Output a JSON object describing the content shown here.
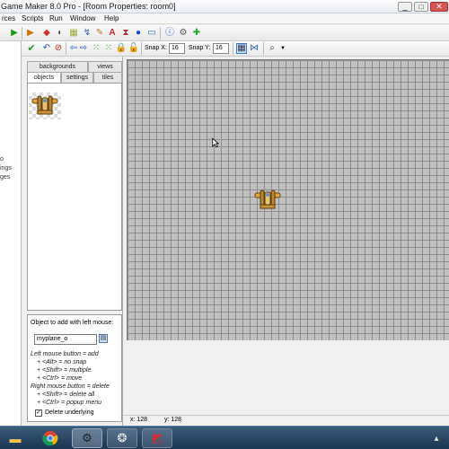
{
  "title": "Game Maker 8.0 Pro - [Room Properties: room0]",
  "menu": {
    "items": [
      "rces",
      "Scripts",
      "Run",
      "Window",
      "Help"
    ]
  },
  "left_strip": {
    "labels": [
      "o",
      "ings",
      "ges"
    ]
  },
  "toolbar2": {
    "snap_x_label": "Snap X:",
    "snap_x_value": "16",
    "snap_y_label": "Snap Y:",
    "snap_y_value": "16"
  },
  "tabs": {
    "backgrounds": "backgrounds",
    "views": "views",
    "objects": "objects",
    "settings": "settings",
    "tiles": "tiles"
  },
  "object_panel": {
    "heading": "Object to add with left mouse:",
    "selected_object": "myplane_o",
    "help_lines": [
      "Left mouse button = add",
      "+ <Alt> = no snap",
      "+ <Shift> = multiple",
      "+ <Ctrl> = move",
      "Right mouse button = delete",
      "+ <Shift> = delete all",
      "+ <Ctrl> = popup menu"
    ],
    "delete_underlying_label": "Delete underlying",
    "delete_underlying_checked": true
  },
  "status": {
    "x": "x: 128",
    "y": "y: 128"
  },
  "colors": {
    "grid_bg": "#c0c0c0",
    "grid_line": "#8f8f8f",
    "taskbar": "#1c3553"
  }
}
